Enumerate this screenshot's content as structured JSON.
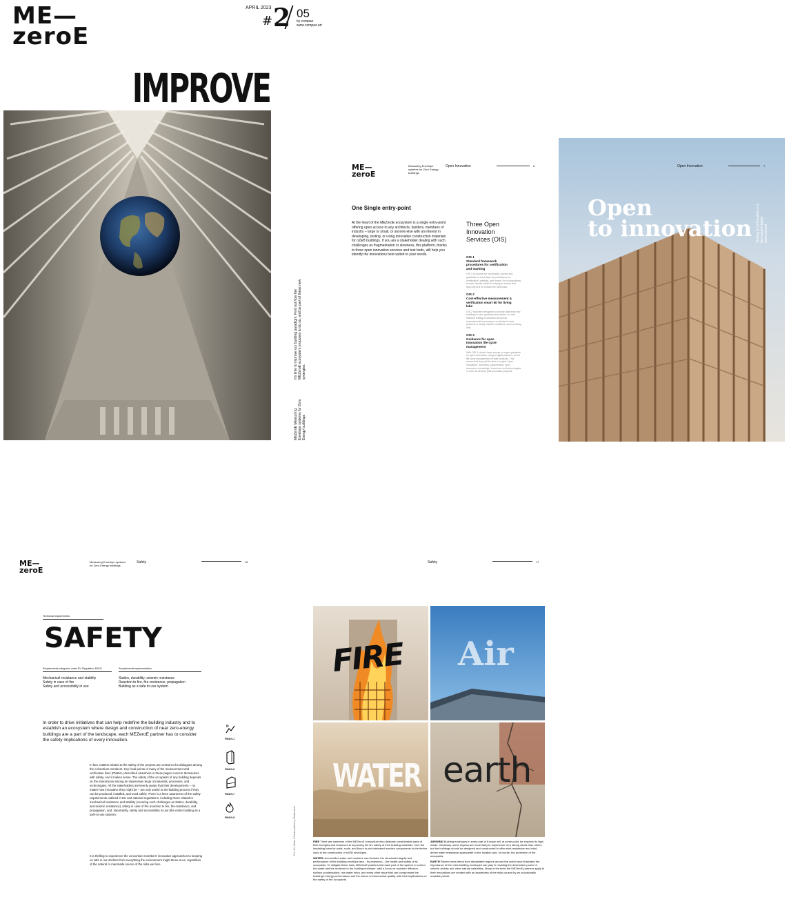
{
  "cover": {
    "logo": "ME—\nzeroE",
    "issue_date": "APRIL 2023",
    "issue_hash": "#",
    "issue_number": "2",
    "issue_of": "05",
    "by_line": "by compaz",
    "url": "www.compaz.art",
    "headline": "IMPROVE",
    "side_text": "It's time to improve our building paradigm. Find out how the MEZeroE ecosystem proposes to do so, and be part of these new synergies.",
    "side_footer": "MEZeroE Measuring Envelope systems for Zero Energy buildings"
  },
  "spread_open": {
    "logo": "ME—\nzeroE",
    "running_head": "Measuring Envelope systems for Zero Energy buildings",
    "section": "Open Innovation",
    "page_left": "6",
    "page_right": "7",
    "heading": "One Single entry-point",
    "body": "At the heart of the MEZeroE ecosystem is a single entry-point offering open access to any architects, builders, members of industry – large or small, or anyone else with an interest in developing, testing, or using innovative construction materials for nZEB buildings. If you are a stakeholder dealing with such challenges as fragmentation or slowness, this platform, thanks to three open innovation services and test beds, will help you identify the innovations best suited to your needs.",
    "ois_title": "Three Open Innovation Services (OIS)",
    "ois": [
      {
        "id": "OIS 1",
        "title": "Standard framework procedures for certification and marking",
        "text": "OIS 1 is a portal for information, advice and guidance on each topic as procedures for certification, marking, and norms. It's a consultancy service. Ideally suited to helping to ensure that each client is on exactly the right track."
      },
      {
        "id": "OIS 2",
        "title": "Cost-effective measurement & verification smart kit for living labs",
        "text": "OIS 2 has been designed to provide data from real buildings in use, guidance and advice on cost-effective testing procedures as well as characterization processes to clients for their products in nearly real life conditions, such as living labs."
      },
      {
        "id": "OIS 3",
        "title": "Guidance for open innovation life cycle management",
        "text": "With OIS 3, clients have access to expert guidance on open innovation, using a digital platform, on the life cycle management of their products. This means that they will be able to exploit \"open innovation\" dynamics, partnerships, open resources, knowledge, know-how and technologies in order to develop joint innovative projects."
      }
    ],
    "open_title": "Open\nto innovation",
    "open_side": "Testing & certification in a fast-paced digital environment"
  },
  "safety_page": {
    "logo": "ME—\nzeroE",
    "running_head": "Measuring Envelope systems for Zero Energy buildings",
    "section": "Safety",
    "page_left": "16",
    "page_right": "17",
    "kicker": "Technical requirements",
    "title": "SAFETY",
    "col1_head": "Requirements categories under EU Regulation 305/11",
    "col2_head": "Requirements implementation",
    "col1": [
      "Mechanical resistance and stability",
      "Safety in case of fire",
      "Safety and accessibility in use"
    ],
    "col2": [
      "Statics, durability, seismic resistance",
      "Reaction to fire, fire resistance, propagation",
      "Building as a safe to use system"
    ],
    "lead": "In order to drive initiatives that can help redefine the building industry and to establish an ecosystem where design and construction of near zero-energy buildings are a part of the landscape, each MEZeroE partner has to consider the safety implications of every innovation.",
    "body1": "In fact, matters related to the safety of the projects are central to the dialogues among the consortium members. Key focal points of many of the measurement and verification lines (PM&VL) described elsewhere in these pages concern themselves with safety. And it makes sense. The safety of the occupants of any building depends on the interactions among an impressive range of materials, processes, and technologies. All the stakeholders are keenly aware that their developments – no matter how innovative they might be – are only useful to the building process if they can be produced, installed, and used safely. There is a keen awareness of the safety requirements outlined in EU and national regulations, including those related to mechanical resistance and stability (covering such challenges as statics, durability, and seismic resistance), safety in case of fire (reaction to fire, fire-resistance, and propagation, and, importantly, safety and accessibility in use (the entire building as a safe-to-use system).",
    "body2": "It is thrilling to experience the consortium members' innovative approaches to keeping us safe in our shelters from everything the environment might throw at us, regardless of the natural or manmade source of the risks we face.",
    "icons": [
      {
        "name": "earthquake",
        "label": "PM&VL1"
      },
      {
        "name": "panel",
        "label": "PM&VL6"
      },
      {
        "name": "frame",
        "label": "PM&VL7"
      },
      {
        "name": "flame",
        "label": "PM&VL8"
      }
    ],
    "credit": "Fire, Air, Water & Earth photos by Shutterstock",
    "tiles": [
      {
        "word": "FIRE",
        "name": "fire"
      },
      {
        "word": "Air",
        "name": "air"
      },
      {
        "word": "WATER",
        "name": "water"
      },
      {
        "word": "earth",
        "name": "earth"
      }
    ],
    "captions_left": [
      {
        "lead": "FIRE",
        "text": "There are members of the MEZeroE consortium who dedicate considerable parts of their energies and resources to improving the fire safety of their building materials, from the insulating foam for walls, roofs, and floors to pre-fabricated wooden components to the timber used in the construction of nZEB envelopes."
      },
      {
        "lead": "WATER",
        "text": "Uncontrolled water and moisture can threaten the structural integrity and performance of the building envelope and – by extension – the health and safety of its occupants. To mitigate these risks, MEZeroE partners test each part of the system to control the water and the moisture in the building envelope, with a focus on moisture diffusion, surface condensation, rain water entry, and every other issue that can compromise the building's energy performance and the indoor environmental quality, with their implications on the safety of the occupants."
      }
    ],
    "captions_right": [
      {
        "lead": "AIR/WIND",
        "text": "Building envelopes in every part of Europe will, at some point, be exposed to high winds. Obviously, some regions are more likely to experience very strong winds than others but the buildings should be designed and constructed to offer wind-resistance and wind-driven water resistance appropriate to the location and, of course, the protection of the occupants."
      },
      {
        "lead": "EARTH",
        "text": "Recent news items from devastated regions around the world have illustrated the importance of the roles building envelopes can play in resisting the destructive power of seismic activity and other natural calamities. Many of the tests the MEZeroE partners apply to their innovations are created with an awareness of the risks caused by an occasionally unstable planet."
      }
    ]
  },
  "colors": {
    "ink": "#111111",
    "sky": "#a8c4dc",
    "grey_text": "#888888"
  }
}
